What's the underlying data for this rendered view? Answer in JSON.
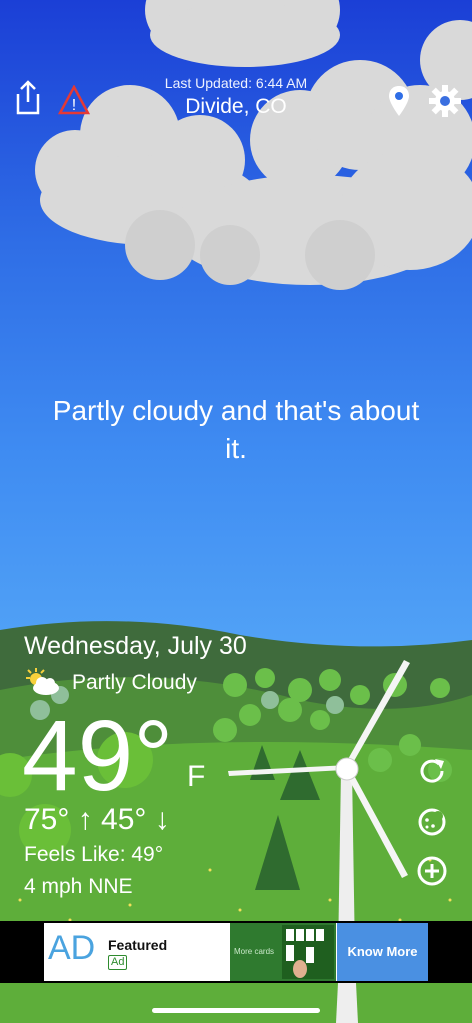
{
  "header": {
    "last_updated": "Last Updated: 6:44 AM",
    "location": "Divide, CO",
    "icons": [
      "share-icon",
      "alert-icon",
      "location-pin-icon",
      "gear-icon"
    ]
  },
  "headline": "Partly cloudy and that's about it.",
  "current": {
    "date": "Wednesday, July 30",
    "condition": "Partly Cloudy",
    "condition_icon": "partly-cloudy-icon",
    "temperature": "49°",
    "unit": "F",
    "hi_lo": "75° ↑  45° ↓",
    "feels_like": "Feels Like: 49°",
    "wind": "4 mph NNE"
  },
  "side_buttons": [
    "refresh-icon",
    "cookie-icon",
    "add-circle-icon"
  ],
  "ad": {
    "logo": "AD",
    "featured": "Featured",
    "tag": "Ad",
    "image_caption": "More cards",
    "cta": "Know More"
  },
  "colors": {
    "sky_top": "#1b3fd6",
    "sky_bottom": "#56a8f7",
    "grass": "#5eae3a",
    "ad_cta": "#4a90e2",
    "alert": "#e53935"
  }
}
